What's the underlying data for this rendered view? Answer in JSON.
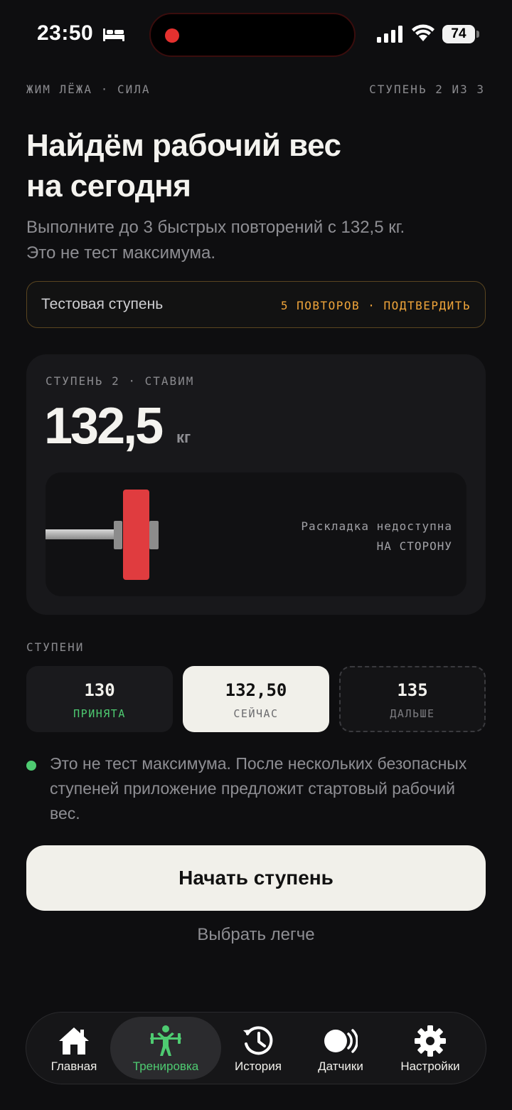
{
  "status_bar": {
    "time": "23:50",
    "battery": "74",
    "icons": [
      "bed-icon",
      "signal-icon",
      "wifi-icon",
      "battery-icon"
    ]
  },
  "header": {
    "exercise": "ЖИМ ЛЁЖА · СИЛА",
    "progress": "СТУПЕНЬ 2 ИЗ 3",
    "title_line1": "Найдём рабочий вес",
    "title_line2": "на сегодня",
    "subtitle_line1": "Выполните до 3 быстрых повторений с 132,5 кг.",
    "subtitle_line2": "Это не тест максимума."
  },
  "banner": {
    "label": "Тестовая ступень",
    "action": "5 ПОВТОРОВ · ПОДТВЕРДИТЬ"
  },
  "weight_card": {
    "eyebrow": "СТУПЕНЬ 2 · СТАВИМ",
    "value": "132,5",
    "unit": "кг",
    "plate_note_line1": "Раскладка недоступна",
    "plate_note_line2": "НА СТОРОНУ",
    "plate_color": "#e03c3f"
  },
  "steps": {
    "label": "СТУПЕНИ",
    "items": [
      {
        "value": "130",
        "status": "ПРИНЯТА"
      },
      {
        "value": "132,50",
        "status": "СЕЙЧАС"
      },
      {
        "value": "135",
        "status": "ДАЛЬШЕ"
      }
    ]
  },
  "info": {
    "text": "Это не тест максимума. После нескольких безопасных ступеней приложение предложит стартовый рабочий вес."
  },
  "actions": {
    "primary": "Начать ступень",
    "secondary": "Выбрать легче"
  },
  "tabbar": {
    "active": "Тренировка",
    "accent": "#4ecb71",
    "items": [
      {
        "label": "Главная",
        "icon": "home-icon"
      },
      {
        "label": "Тренировка",
        "icon": "weightlifter-icon"
      },
      {
        "label": "История",
        "icon": "history-icon"
      },
      {
        "label": "Датчики",
        "icon": "sensor-icon"
      },
      {
        "label": "Настройки",
        "icon": "gear-icon"
      }
    ]
  }
}
